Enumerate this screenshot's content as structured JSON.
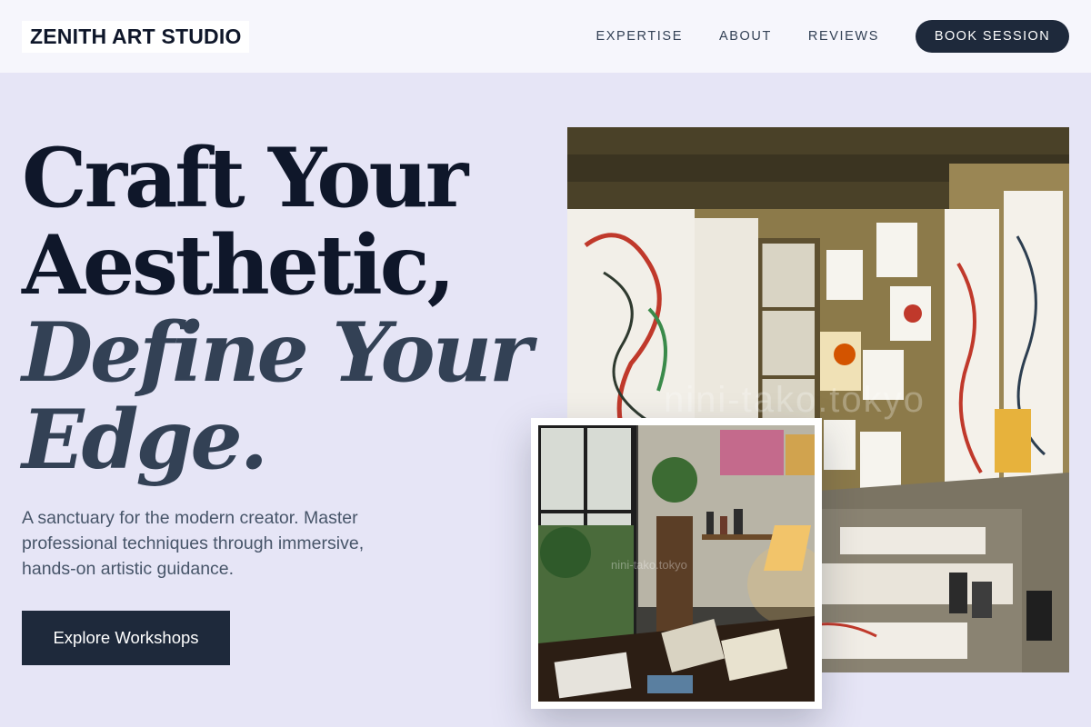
{
  "header": {
    "brand": "ZENITH ART STUDIO",
    "nav": [
      "EXPERTISE",
      "ABOUT",
      "REVIEWS"
    ],
    "book_label": "BOOK SESSION"
  },
  "hero": {
    "line1": "Craft Your",
    "line2": "Aesthetic,",
    "line3": "Define Your",
    "line4": "Edge.",
    "subtext": "A sanctuary for the modern creator. Master professional techniques through immersive, hands-on artistic guidance.",
    "cta_label": "Explore Workshops"
  },
  "images": {
    "main_watermark": "nini-tako.tokyo",
    "inset_watermark": "nini-tako.tokyo"
  },
  "colors": {
    "page_bg": "#e6e5f6",
    "header_bg": "#f6f6fc",
    "accent_dark": "#1e293b",
    "headline": "#0f172a",
    "headline_italic": "#334155"
  }
}
